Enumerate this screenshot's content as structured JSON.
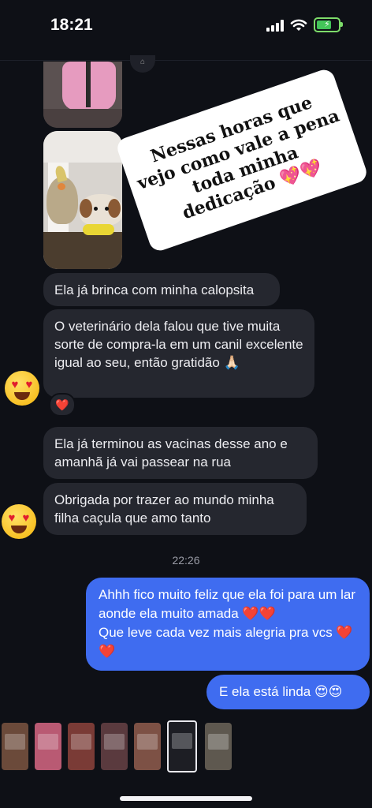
{
  "status_bar": {
    "time": "18:21",
    "icons": [
      "cellular-signal-icon",
      "wifi-icon",
      "battery-charging-icon"
    ],
    "battery_color": "#43c559"
  },
  "overlay_sticker": {
    "text": "Nessas horas que vejo como vale a pena toda minha dedicação 💖💖"
  },
  "messages": [
    {
      "direction": "received",
      "text": "Ela já brinca com minha calopsita"
    },
    {
      "direction": "received",
      "text": "O veterinário dela falou que tive muita sorte de compra-la em um canil excelente igual ao seu, então gratidão 🙏🏻",
      "reaction": "❤️"
    },
    {
      "direction": "received",
      "text": "Ela já terminou as vacinas desse ano e amanhã já vai passear na rua"
    },
    {
      "direction": "received",
      "text": "Obrigada por trazer ao mundo minha filha caçula que amo tanto"
    },
    {
      "direction": "sent",
      "lines": [
        "Ahhh fico muito feliz que ela foi para um lar aonde ela muito amada ❤️❤️",
        "Que leve cada vez mais alegria pra vcs ❤️❤️"
      ]
    },
    {
      "direction": "sent",
      "text": "E ela está linda 😍😍"
    }
  ],
  "timestamp": "22:26",
  "colors": {
    "background": "#0e1016",
    "received_bubble": "#25272f",
    "sent_bubble": "#3f6cf0"
  },
  "story_thumbnails": [
    {
      "bg": "#6b4a3a"
    },
    {
      "bg": "#b95a73"
    },
    {
      "bg": "#7a3b36"
    },
    {
      "bg": "#5a3a3e"
    },
    {
      "bg": "#7d5145"
    },
    {
      "bg": "#1d1e24",
      "active": true
    },
    {
      "bg": "#5e584f"
    }
  ]
}
